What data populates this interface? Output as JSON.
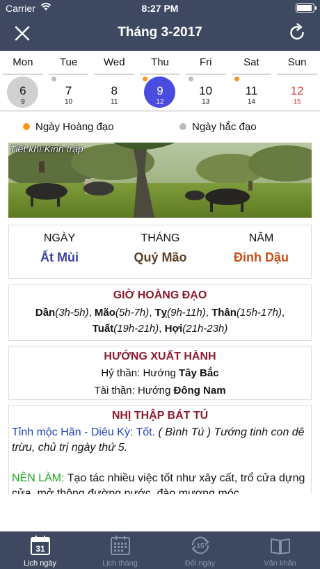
{
  "status": {
    "carrier": "Carrier",
    "time": "8:27 PM",
    "battery_level": 0.95
  },
  "nav": {
    "title": "Tháng 3-2017",
    "left_icon": "close-icon",
    "right_icon": "refresh-icon"
  },
  "week": {
    "days": [
      {
        "name": "Mon",
        "solar": "6",
        "lunar": "9",
        "dot": "",
        "state": "today"
      },
      {
        "name": "Tue",
        "solar": "7",
        "lunar": "10",
        "dot": "gray",
        "state": ""
      },
      {
        "name": "Wed",
        "solar": "8",
        "lunar": "11",
        "dot": "",
        "state": ""
      },
      {
        "name": "Thu",
        "solar": "9",
        "lunar": "12",
        "dot": "orange",
        "state": "selected"
      },
      {
        "name": "Fri",
        "solar": "10",
        "lunar": "13",
        "dot": "gray",
        "state": ""
      },
      {
        "name": "Sat",
        "solar": "11",
        "lunar": "14",
        "dot": "orange",
        "state": ""
      },
      {
        "name": "Sun",
        "solar": "12",
        "lunar": "15",
        "dot": "",
        "state": "sunday"
      }
    ]
  },
  "legend": {
    "good": "Ngày Hoàng đạo",
    "bad": "Ngày hắc đạo",
    "good_color": "#f39a1e",
    "bad_color": "#bbbbbb"
  },
  "photo": {
    "caption": "Tiết khí:Kinh trập"
  },
  "ganzhi": {
    "day_label": "NGÀY",
    "day_value": "Ất Mùi",
    "day_color": "#3b3fa6",
    "month_label": "THÁNG",
    "month_value": "Quý Mão",
    "month_color": "#5a3f22",
    "year_label": "NĂM",
    "year_value": "Đinh Dậu",
    "year_color": "#c8501a"
  },
  "hours": {
    "title": "GIỜ HOÀNG ĐẠO",
    "items": [
      {
        "name": "Dần",
        "range": "(3h-5h)"
      },
      {
        "name": "Mão",
        "range": "(5h-7h)"
      },
      {
        "name": "Tỵ",
        "range": "(9h-11h)"
      },
      {
        "name": "Thân",
        "range": "(15h-17h)"
      },
      {
        "name": "Tuất",
        "range": "(19h-21h)"
      },
      {
        "name": "Hợi",
        "range": "(21h-23h)"
      }
    ]
  },
  "direction": {
    "title": "HƯỚNG XUẤT HÀNH",
    "hy_label": "Hỷ thần: Hướng ",
    "hy_value": "Tây Bắc",
    "tai_label": "Tài thần: Hướng ",
    "tai_value": "Đông Nam"
  },
  "stars": {
    "title": "NHỊ THẬP BÁT TÚ",
    "star_name": "Tỉnh mộc Hãn - Diêu Kỳ: Tốt.",
    "star_desc": " ( Bình Tú ) Tướng tinh con dê trừu, chủ trị ngày thứ 5.",
    "do_label": "NÊN LÀM:",
    "do_text": " Tạo tác nhiều việc tốt như xây cất, trổ cửa dựng cửa, mở thông đường nước, đào mương móc"
  },
  "tabs": [
    {
      "label": "Lịch ngày",
      "icon": "calendar-day-icon",
      "day_number": "31",
      "active": true
    },
    {
      "label": "Lịch tháng",
      "icon": "calendar-month-icon",
      "active": false
    },
    {
      "label": "Đổi ngày",
      "icon": "convert-date-icon",
      "day_number": "15",
      "active": false
    },
    {
      "label": "Văn khấn",
      "icon": "book-icon",
      "active": false
    }
  ]
}
